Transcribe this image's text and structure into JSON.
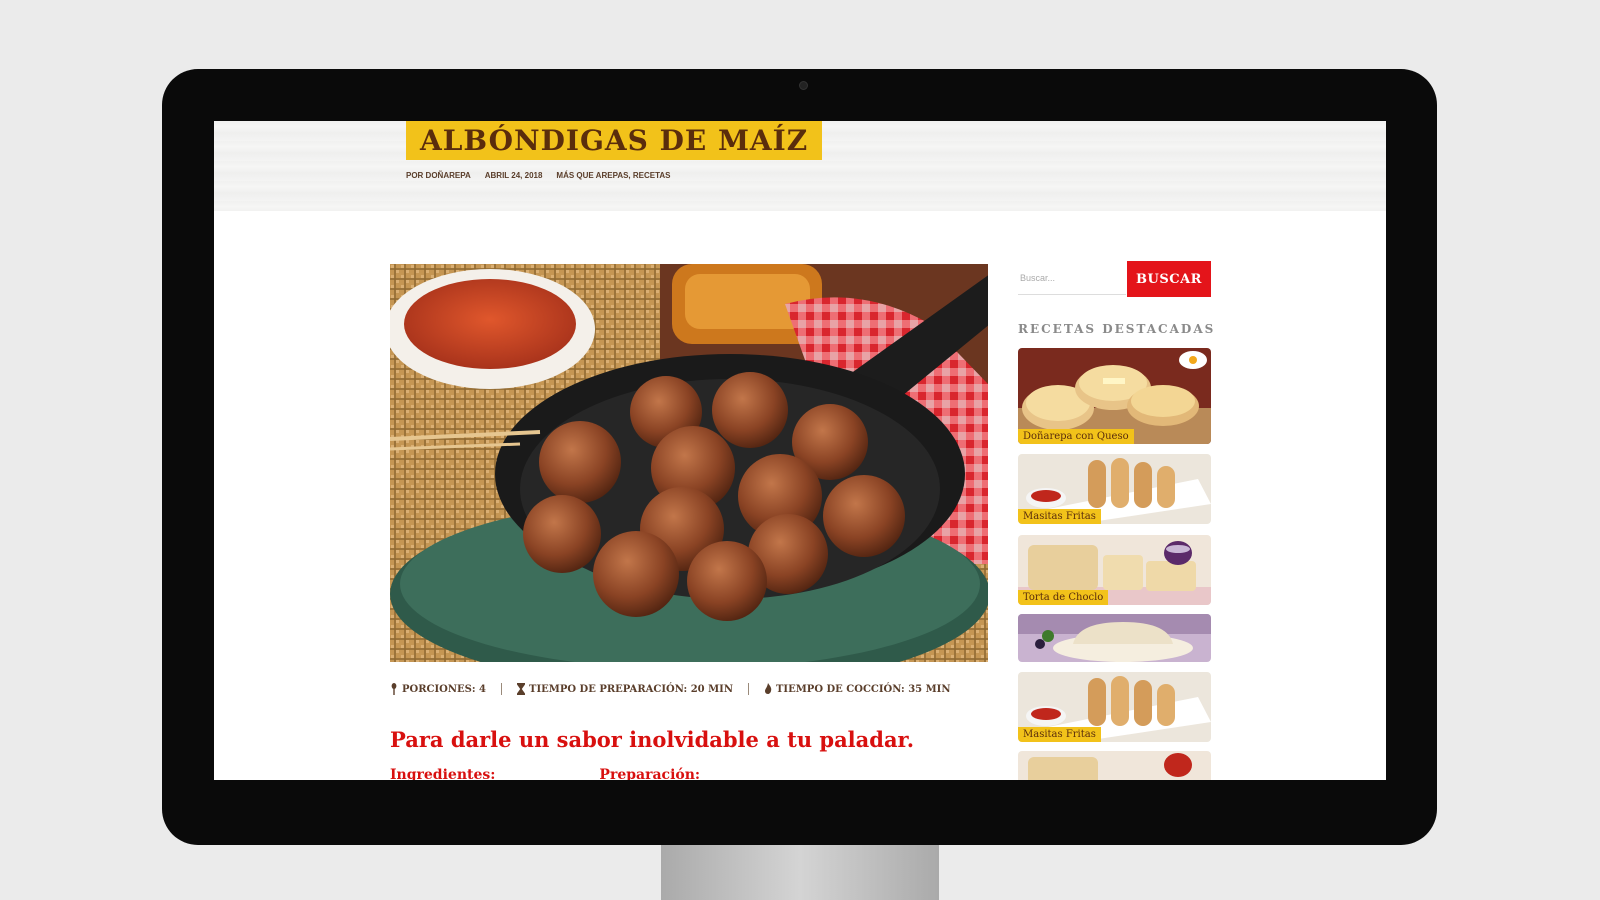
{
  "post": {
    "title": "ALBÓNDIGAS DE MAÍZ",
    "author": "POR DOÑAREPA",
    "date": "ABRIL 24, 2018",
    "categories": "MÁS QUE AREPAS, RECETAS"
  },
  "recipe_info": {
    "servings": "PORCIONES: 4",
    "prep_time": "TIEMPO DE PREPARACIÓN: 20 MIN",
    "cook_time": "TIEMPO DE COCCIÓN: 35 MIN"
  },
  "content": {
    "tagline": "Para darle un sabor inolvidable a tu paladar.",
    "ingredients_heading": "Ingredientes:",
    "preparation_heading": "Preparación:"
  },
  "sidebar": {
    "search_placeholder": "Buscar...",
    "search_button": "BUSCAR",
    "featured_heading": "RECETAS DESTACADAS",
    "featured": [
      {
        "label": "Doñarepa con Queso"
      },
      {
        "label": "Masitas Fritas"
      },
      {
        "label": "Torta de Choclo"
      },
      {
        "label": ""
      },
      {
        "label": "Masitas Fritas"
      },
      {
        "label": ""
      }
    ]
  },
  "colors": {
    "accent_yellow": "#f2c21a",
    "accent_red": "#e4141a",
    "title_brown": "#5a2d0c"
  }
}
